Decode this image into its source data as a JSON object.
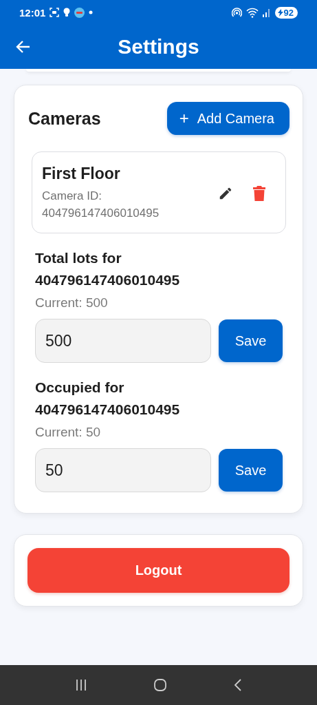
{
  "status_bar": {
    "time": "12:01",
    "battery": "92"
  },
  "header": {
    "title": "Settings"
  },
  "cameras_card": {
    "title": "Cameras",
    "add_button": {
      "icon": "+",
      "label": "Add Camera"
    },
    "cameras": [
      {
        "name": "First Floor",
        "id_text": "Camera ID: 404796147406010495"
      }
    ],
    "settings": [
      {
        "label": "Total lots for 404796147406010495",
        "current": "Current: 500",
        "value": "500",
        "button": "Save"
      },
      {
        "label": "Occupied for 404796147406010495",
        "current": "Current: 50",
        "value": "50",
        "button": "Save"
      }
    ]
  },
  "logout": {
    "label": "Logout"
  }
}
